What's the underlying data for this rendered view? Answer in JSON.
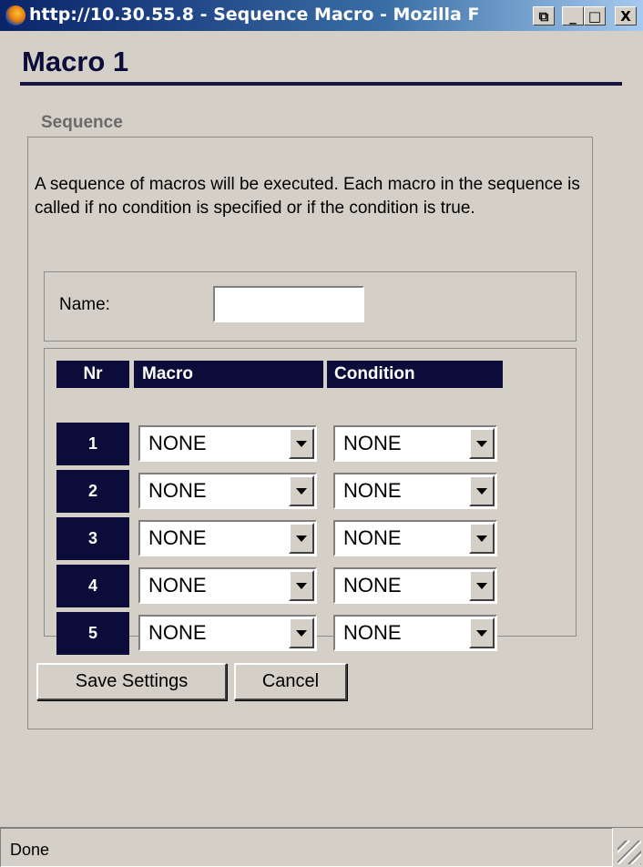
{
  "window": {
    "title": "http://10.30.55.8 - Sequence Macro - Mozilla F",
    "restore_glyph": "⧉",
    "minimize_glyph": "_",
    "maximize_glyph": "□",
    "close_glyph": "X"
  },
  "page": {
    "title": "Macro 1",
    "section_legend": "Sequence",
    "description": "A sequence of macros will be executed. Each macro in the sequence is called if no condition is specified or if the condition is true.",
    "name_label": "Name:",
    "name_value": ""
  },
  "table": {
    "headers": {
      "nr": "Nr",
      "macro": "Macro",
      "condition": "Condition"
    },
    "rows": [
      {
        "nr": "1",
        "macro": "NONE",
        "condition": "NONE"
      },
      {
        "nr": "2",
        "macro": "NONE",
        "condition": "NONE"
      },
      {
        "nr": "3",
        "macro": "NONE",
        "condition": "NONE"
      },
      {
        "nr": "4",
        "macro": "NONE",
        "condition": "NONE"
      },
      {
        "nr": "5",
        "macro": "NONE",
        "condition": "NONE"
      }
    ]
  },
  "buttons": {
    "save": "Save Settings",
    "cancel": "Cancel"
  },
  "status": {
    "text": "Done"
  },
  "colors": {
    "header_navy": "#0c0c3a",
    "background": "#d4d0c8"
  }
}
